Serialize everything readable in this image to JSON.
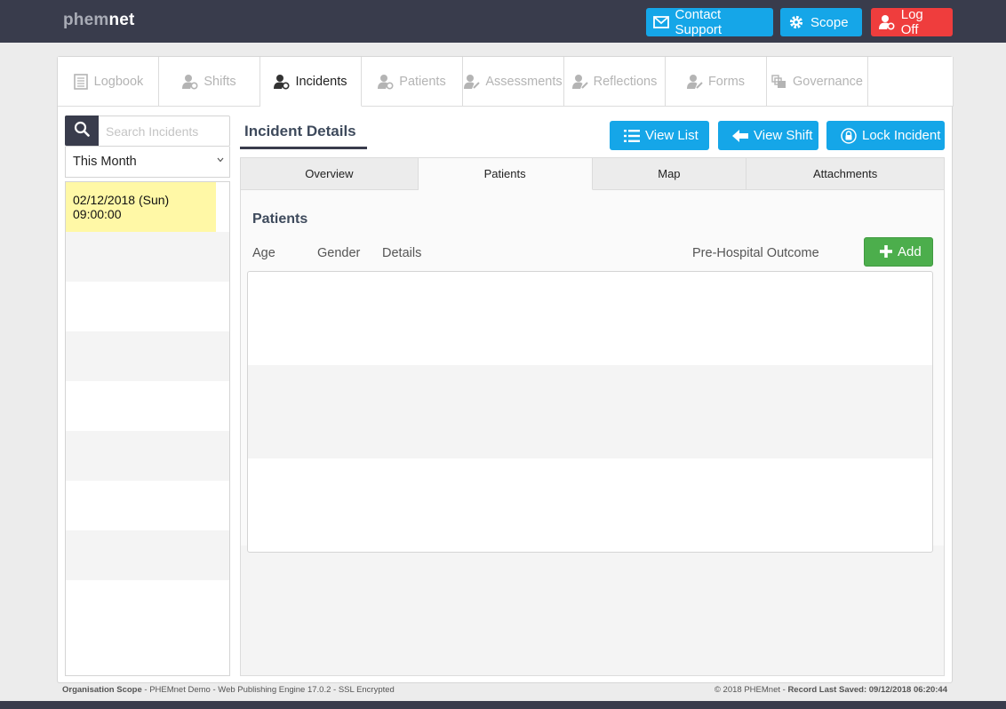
{
  "app": {
    "logo_part1": "phem",
    "logo_part2": "net"
  },
  "header": {
    "contact_support": "Contact Support",
    "scope": "Scope",
    "log_off": "Log Off"
  },
  "modules": [
    {
      "label": "Logbook",
      "icon": "logbook-icon"
    },
    {
      "label": "Shifts",
      "icon": "shifts-icon"
    },
    {
      "label": "Incidents",
      "icon": "incidents-icon",
      "active": true
    },
    {
      "label": "Patients",
      "icon": "patients-icon"
    },
    {
      "label": "Assessments",
      "icon": "assessments-icon"
    },
    {
      "label": "Reflections",
      "icon": "reflections-icon"
    },
    {
      "label": "Forms",
      "icon": "forms-icon"
    },
    {
      "label": "Governance",
      "icon": "governance-icon"
    }
  ],
  "sidebar": {
    "search_placeholder": "Search Incidents",
    "filter_value": "This Month",
    "incidents": [
      {
        "date": "02/12/2018 (Sun)",
        "time": "09:00:00",
        "selected": true
      }
    ]
  },
  "detail": {
    "title": "Incident Details",
    "view_list": "View List",
    "view_shift": "View Shift",
    "lock_incident": "Lock Incident",
    "tabs": [
      "Overview",
      "Patients",
      "Map",
      "Attachments"
    ],
    "active_tab": "Patients"
  },
  "patients": {
    "title": "Patients",
    "columns": {
      "age": "Age",
      "gender": "Gender",
      "details": "Details",
      "outcome": "Pre-Hospital Outcome"
    },
    "add_label": "Add",
    "rows": []
  },
  "footer": {
    "left_bold": "Organisation Scope",
    "left_text": " - PHEMnet Demo - Web Publishing Engine 17.0.2 - SSL Encrypted",
    "right_text": "© 2018 PHEMnet - ",
    "right_bold": "Record Last Saved: 09/12/2018 06:20:44"
  },
  "colors": {
    "topbar": "#393c4c",
    "primary": "#15a6e8",
    "danger": "#ef3d3d",
    "success": "#4cae4c",
    "selected_row": "#fff8a6"
  }
}
